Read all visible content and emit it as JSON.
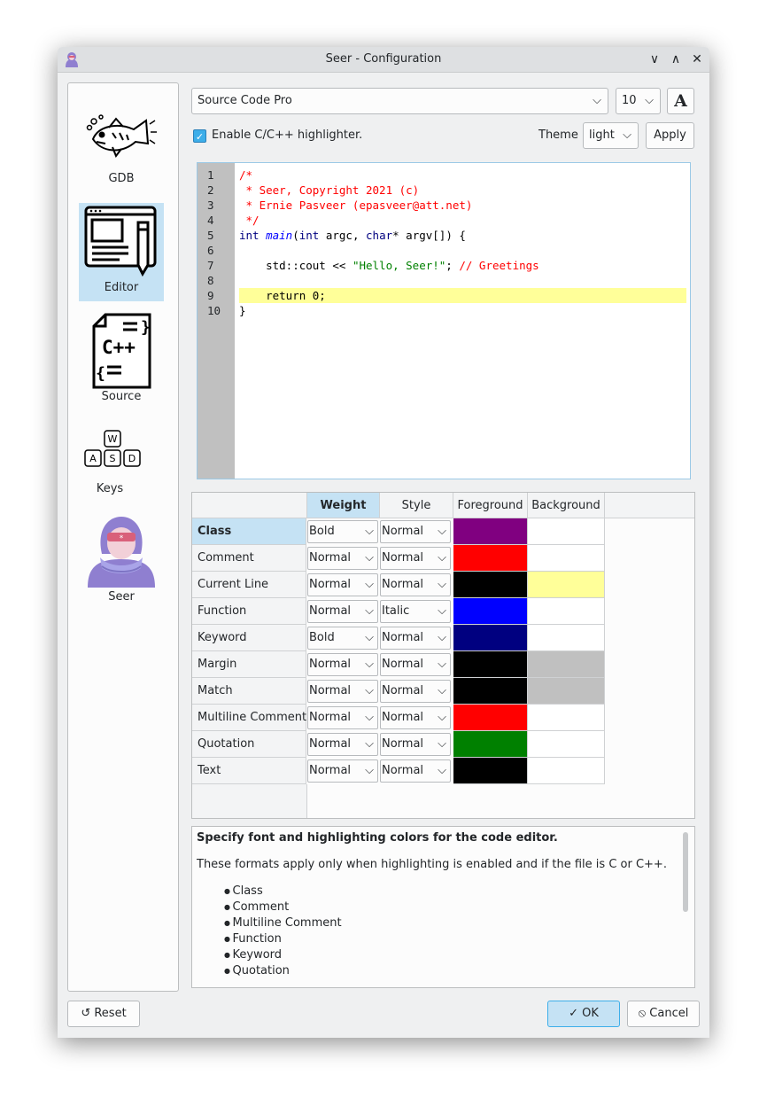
{
  "window": {
    "title": "Seer - Configuration",
    "minimize_glyph": "∨",
    "maximize_glyph": "∧",
    "close_glyph": "✕"
  },
  "sidebar": {
    "items": [
      {
        "label": "GDB",
        "icon": "fish-icon"
      },
      {
        "label": "Editor",
        "icon": "editor-icon",
        "selected": true
      },
      {
        "label": "Source",
        "icon": "cpp-source-icon"
      },
      {
        "label": "Keys",
        "icon": "keys-icon"
      },
      {
        "label": "Seer",
        "icon": "seer-icon"
      }
    ]
  },
  "font": {
    "family": "Source Code Pro",
    "size": "10",
    "font_button": "A"
  },
  "highlighter": {
    "enable_label": "Enable C/C++ highlighter.",
    "checked": true,
    "theme_label": "Theme",
    "theme_value": "light",
    "apply_label": "Apply"
  },
  "editor": {
    "line_numbers": [
      "1",
      "2",
      "3",
      "4",
      "5",
      "6",
      "7",
      "8",
      "9",
      "10"
    ],
    "lines": [
      [
        {
          "t": "/*",
          "c": "comment"
        }
      ],
      [
        {
          "t": " * Seer, Copyright 2021 (c)",
          "c": "comment"
        }
      ],
      [
        {
          "t": " * Ernie Pasveer (epasveer@att.net)",
          "c": "comment"
        }
      ],
      [
        {
          "t": " */",
          "c": "comment"
        }
      ],
      [
        {
          "t": "int",
          "c": "keyword"
        },
        {
          "t": " ",
          "c": "text"
        },
        {
          "t": "main",
          "c": "func"
        },
        {
          "t": "(",
          "c": "text"
        },
        {
          "t": "int",
          "c": "keyword"
        },
        {
          "t": " argc, ",
          "c": "text"
        },
        {
          "t": "char",
          "c": "keyword"
        },
        {
          "t": "* argv[]) {",
          "c": "text"
        }
      ],
      [
        {
          "t": "",
          "c": "text"
        }
      ],
      [
        {
          "t": "    std::cout << ",
          "c": "text"
        },
        {
          "t": "\"Hello, Seer!\"",
          "c": "quote"
        },
        {
          "t": "; ",
          "c": "text"
        },
        {
          "t": "// Greetings",
          "c": "comment"
        }
      ],
      [
        {
          "t": "",
          "c": "text"
        }
      ],
      [
        {
          "t": "    return 0;",
          "c": "text"
        }
      ],
      [
        {
          "t": "}",
          "c": "text"
        }
      ]
    ],
    "current_line": 9
  },
  "table": {
    "headers": [
      "Weight",
      "Style",
      "Foreground",
      "Background"
    ],
    "rows": [
      {
        "name": "Class",
        "weight": "Bold",
        "style": "Normal",
        "fg": "#800080",
        "bg": "#ffffff"
      },
      {
        "name": "Comment",
        "weight": "Normal",
        "style": "Normal",
        "fg": "#ff0000",
        "bg": "#ffffff"
      },
      {
        "name": "Current Line",
        "weight": "Normal",
        "style": "Normal",
        "fg": "#000000",
        "bg": "#ffff99"
      },
      {
        "name": "Function",
        "weight": "Normal",
        "style": "Italic",
        "fg": "#0000ff",
        "bg": "#ffffff"
      },
      {
        "name": "Keyword",
        "weight": "Bold",
        "style": "Normal",
        "fg": "#000080",
        "bg": "#ffffff"
      },
      {
        "name": "Margin",
        "weight": "Normal",
        "style": "Normal",
        "fg": "#000000",
        "bg": "#c0c0c0"
      },
      {
        "name": "Match",
        "weight": "Normal",
        "style": "Normal",
        "fg": "#000000",
        "bg": "#c0c0c0"
      },
      {
        "name": "Multiline Comment",
        "weight": "Normal",
        "style": "Normal",
        "fg": "#ff0000",
        "bg": "#ffffff"
      },
      {
        "name": "Quotation",
        "weight": "Normal",
        "style": "Normal",
        "fg": "#008000",
        "bg": "#ffffff"
      },
      {
        "name": "Text",
        "weight": "Normal",
        "style": "Normal",
        "fg": "#000000",
        "bg": "#ffffff"
      }
    ]
  },
  "help": {
    "heading": "Specify font and highlighting colors for the code editor.",
    "body": "These formats apply only when highlighting is enabled and if the file is C or C++.",
    "bullets": [
      "Class",
      "Comment",
      "Multiline Comment",
      "Function",
      "Keyword",
      "Quotation"
    ]
  },
  "footer": {
    "reset_label": "Reset",
    "ok_label": "OK",
    "cancel_label": "Cancel"
  },
  "colors": {
    "accent": "#3daee9",
    "selection": "#c5e2f4",
    "current_line": "#ffff99",
    "gutter": "#c0c0c0"
  }
}
